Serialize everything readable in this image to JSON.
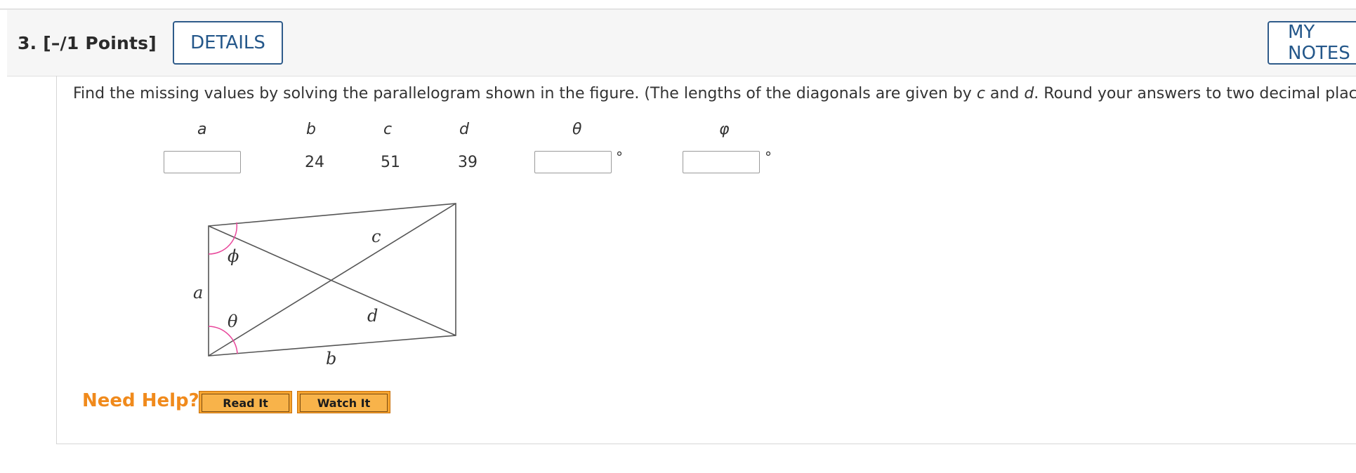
{
  "question": {
    "number_label": "3.  [–/1 Points]",
    "details_label": "DETAILS",
    "my_notes_label": "MY NOTES"
  },
  "prompt": {
    "part1": "Find the missing values by solving the parallelogram shown in the figure. (The lengths of the diagonals are given by ",
    "c": "c",
    "and": " and ",
    "d": "d",
    "part2": ". Round your answers to two decimal places.)"
  },
  "table": {
    "headers": {
      "a": "a",
      "b": "b",
      "c": "c",
      "d": "d",
      "theta": "θ",
      "phi": "φ"
    },
    "values": {
      "b": "24",
      "c": "51",
      "d": "39"
    },
    "degree_symbol": "°"
  },
  "figure": {
    "labels": {
      "a": "a",
      "b": "b",
      "c": "c",
      "d": "d",
      "theta": "θ",
      "phi": "ϕ"
    },
    "colors": {
      "lines": "#555555",
      "angle_arc": "#e8469a"
    }
  },
  "help": {
    "need_help": "Need Help?",
    "read_it": "Read It",
    "watch_it": "Watch It"
  }
}
